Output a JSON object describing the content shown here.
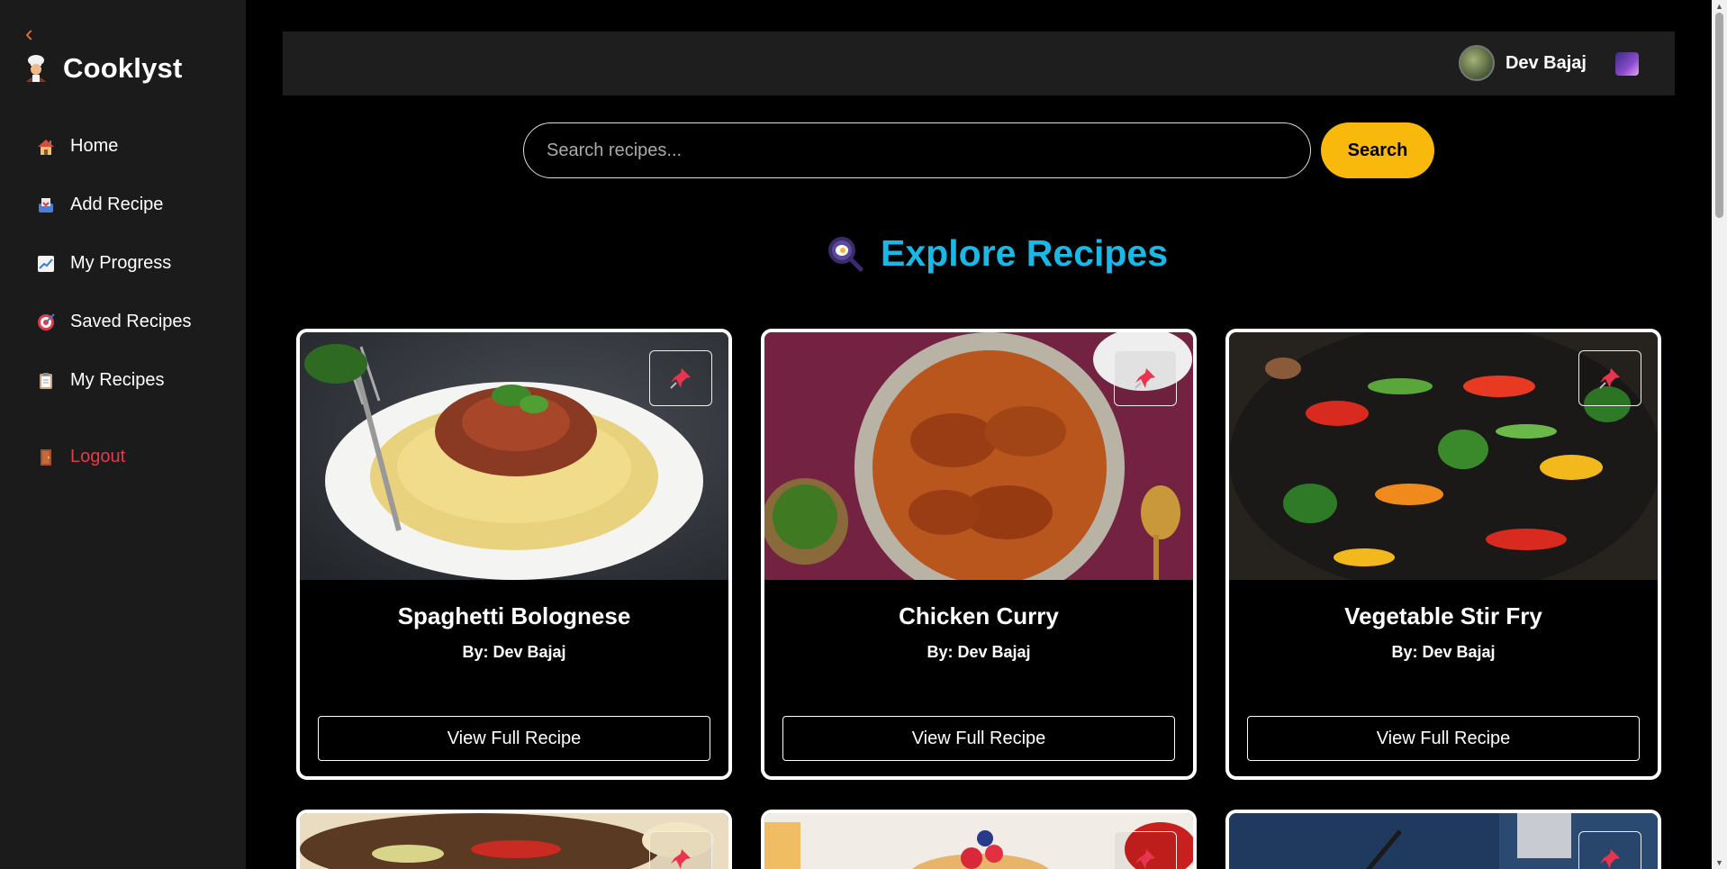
{
  "sidebar": {
    "back_icon": "chevron-left-icon",
    "brand": {
      "name": "Cooklyst",
      "icon": "chef-icon"
    },
    "items": [
      {
        "label": "Home",
        "icon": "house-icon"
      },
      {
        "label": "Add Recipe",
        "icon": "inbox-tray-icon"
      },
      {
        "label": "My Progress",
        "icon": "chart-increasing-icon"
      },
      {
        "label": "Saved Recipes",
        "icon": "target-icon"
      },
      {
        "label": "My Recipes",
        "icon": "clipboard-icon"
      }
    ],
    "logout": {
      "label": "Logout",
      "icon": "door-icon",
      "color": "#e33a4b"
    }
  },
  "header": {
    "user_name": "Dev Bajaj",
    "theme_icon": "night-sky-icon"
  },
  "search": {
    "placeholder": "Search recipes...",
    "button_label": "Search",
    "button_color": "#f8b90c"
  },
  "section": {
    "title": "Explore Recipes",
    "icon": "frying-pan-icon",
    "color": "#1ab8e6"
  },
  "recipes": [
    {
      "title": "Spaghetti Bolognese",
      "author": "By: Dev Bajaj",
      "button": "View Full Recipe",
      "pin_icon": "pushpin-icon"
    },
    {
      "title": "Chicken Curry",
      "author": "By: Dev Bajaj",
      "button": "View Full Recipe",
      "pin_icon": "pushpin-icon"
    },
    {
      "title": "Vegetable Stir Fry",
      "author": "By: Dev Bajaj",
      "button": "View Full Recipe",
      "pin_icon": "pushpin-icon"
    }
  ]
}
